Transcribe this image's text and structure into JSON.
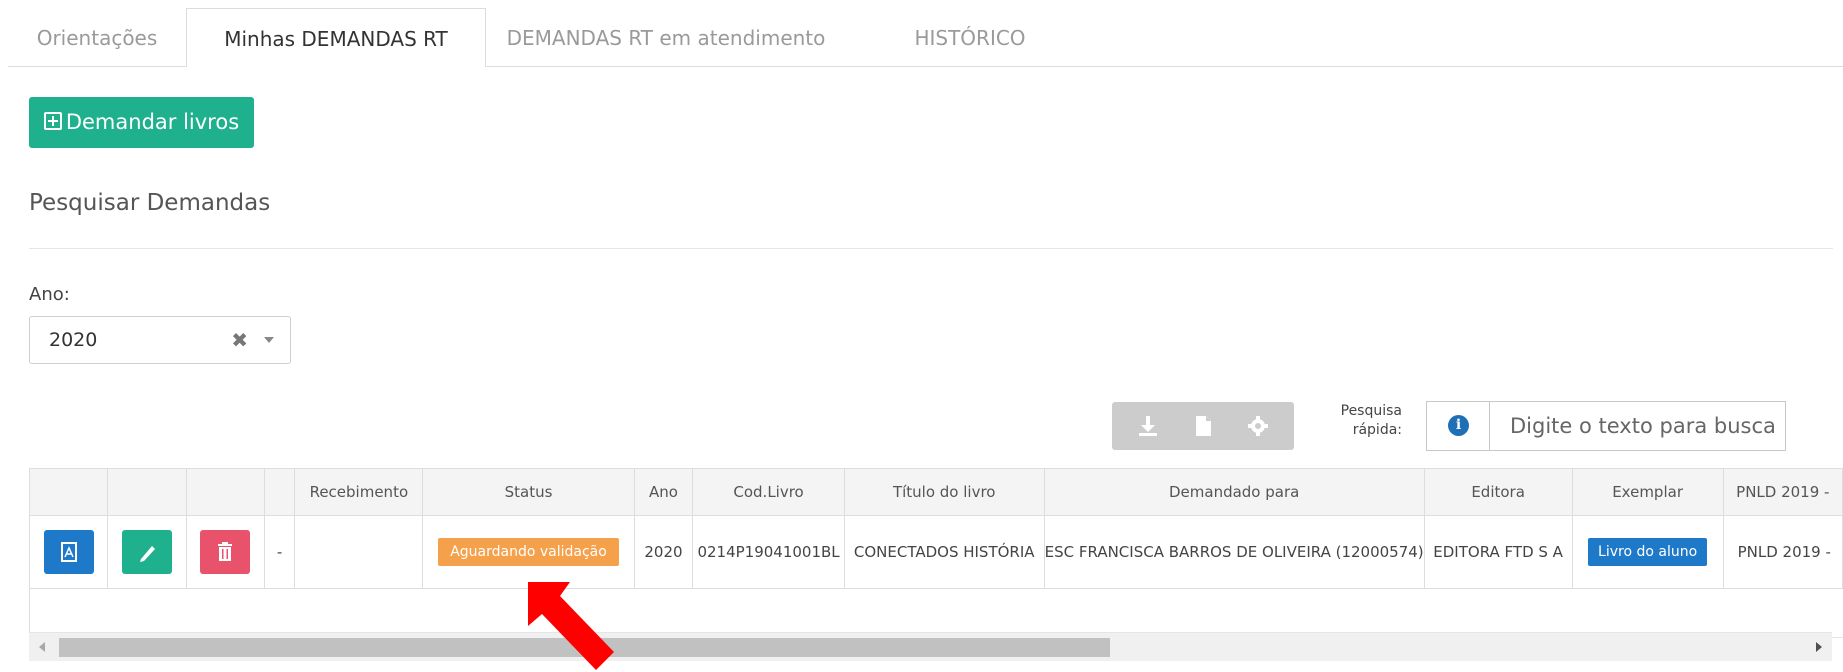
{
  "tabs": [
    {
      "label": "Orientações"
    },
    {
      "label": "Minhas DEMANDAS RT",
      "active": true
    },
    {
      "label": "DEMANDAS RT em atendimento"
    },
    {
      "label": "HISTÓRICO"
    }
  ],
  "actions": {
    "demand_button": "Demandar livros"
  },
  "section": {
    "title": "Pesquisar Demandas"
  },
  "filters": {
    "ano_label": "Ano:",
    "ano_value": "2020",
    "clear_symbol": "✖"
  },
  "toolbar": {
    "icons": [
      "download-icon",
      "file-icon",
      "gear-icon"
    ]
  },
  "search": {
    "label_line1": "Pesquisa",
    "label_line2": "rápida:",
    "info_symbol": "i",
    "placeholder": "Digite o texto para busca"
  },
  "table": {
    "headers": [
      "",
      "",
      "",
      "",
      "Recebimento",
      "Status",
      "Ano",
      "Cod.Livro",
      "Título do livro",
      "Demandado para",
      "Editora",
      "Exemplar",
      "PNLD 2019 -"
    ],
    "rows": [
      {
        "dash": "-",
        "recebimento": "",
        "status": "Aguardando validação",
        "ano": "2020",
        "cod_livro": "0214P19041001BL",
        "titulo": "CONECTADOS HISTÓRIA",
        "demandado_para": "ESC FRANCISCA BARROS DE OLIVEIRA (12000574)",
        "editora": "EDITORA FTD S A",
        "exemplar": "Livro do aluno",
        "programa": "PNLD 2019 -"
      }
    ]
  },
  "colors": {
    "primary_green": "#1fb08e",
    "primary_blue": "#1e7ac9",
    "danger_red": "#e8526b",
    "warning_orange": "#f5a04b",
    "annotation_arrow": "#ff0000"
  }
}
